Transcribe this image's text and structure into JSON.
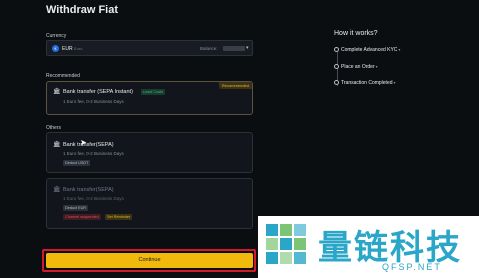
{
  "page": {
    "title": "Withdraw Fiat"
  },
  "currency": {
    "label": "Currency",
    "coin_symbol": "€",
    "code": "EUR",
    "name": "Euro",
    "balance_label": "Balance:"
  },
  "sections": {
    "recommended": "Recommended",
    "others": "Others"
  },
  "methods": [
    {
      "title": "Bank transfer (SEPA Instant)",
      "tag": "Least Costs",
      "badge": "Recommended",
      "subtitle": "1 Euro fee, 0-2 Business Days"
    },
    {
      "title": "Bank transfer(SEPA)",
      "subtitle": "1 Euro fee, 0-2 Business Days",
      "tag": "Deduct USDT"
    },
    {
      "title": "Bank transfer(SEPA)",
      "subtitle": "1 Euro fee, 0-2 Business Days",
      "tag": "Deduct EUR",
      "status": "Channel suspended",
      "action": "Set Reminder"
    }
  ],
  "continue_label": "Continue",
  "how_it_works": {
    "title": "How it works?",
    "steps": [
      "Complete Advanced KYC",
      "Place an Order",
      "Transaction Completed"
    ]
  },
  "watermark": {
    "text": "量链科技",
    "sub": "QFSP.NET"
  },
  "colors": {
    "accent": "#f0b90b",
    "background": "#0b0e11",
    "success": "#2ebd85",
    "danger": "#f6465d",
    "highlight": "#d11a2a"
  }
}
